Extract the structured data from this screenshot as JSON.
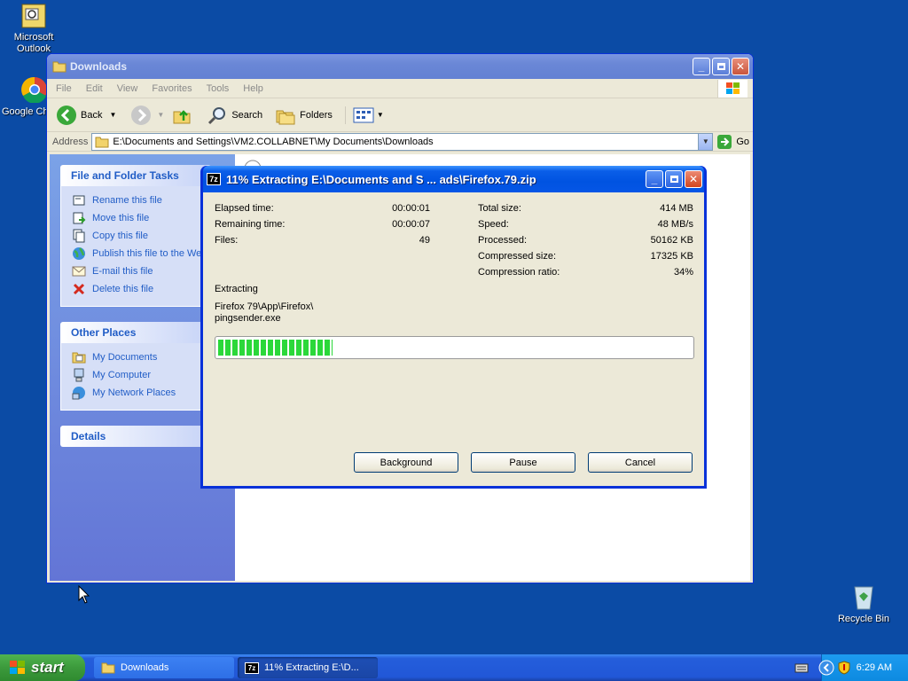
{
  "desktop": {
    "icons": [
      {
        "label": "Microsoft Outlook"
      },
      {
        "label": "Google Ch"
      },
      {
        "label": "Recycle Bin"
      }
    ]
  },
  "explorer": {
    "title": "Downloads",
    "menu": [
      "File",
      "Edit",
      "View",
      "Favorites",
      "Tools",
      "Help"
    ],
    "toolbar": {
      "back": "Back",
      "search": "Search",
      "folders": "Folders"
    },
    "address": {
      "label": "Address",
      "value": "E:\\Documents and Settings\\VM2.COLLABNET\\My Documents\\Downloads",
      "go": "Go"
    },
    "tasks": {
      "file_folder_title": "File and Folder Tasks",
      "file_folder_items": [
        "Rename this file",
        "Move this file",
        "Copy this file",
        "Publish this file to the Web",
        "E-mail this file",
        "Delete this file"
      ],
      "other_places_title": "Other Places",
      "other_places_items": [
        "My Documents",
        "My Computer",
        "My Network Places"
      ],
      "details_title": "Details"
    }
  },
  "dialog": {
    "title": "11% Extracting E:\\Documents and S ... ads\\Firefox.79.zip",
    "stats_left": [
      {
        "label": "Elapsed time:",
        "value": "00:00:01"
      },
      {
        "label": "Remaining time:",
        "value": "00:00:07"
      },
      {
        "label": "Files:",
        "value": "49"
      }
    ],
    "stats_right": [
      {
        "label": "Total size:",
        "value": "414 MB"
      },
      {
        "label": "Speed:",
        "value": "48 MB/s"
      },
      {
        "label": "Processed:",
        "value": "50162 KB"
      },
      {
        "label": "Compressed size:",
        "value": "17325 KB"
      },
      {
        "label": "Compression ratio:",
        "value": "34%"
      }
    ],
    "status": "Extracting",
    "current_path": "Firefox 79\\App\\Firefox\\",
    "current_file": "pingsender.exe",
    "progress_percent": 11,
    "buttons": {
      "background": "Background",
      "pause": "Pause",
      "cancel": "Cancel"
    },
    "accent_color": "#2bd83a"
  },
  "taskbar": {
    "start": "start",
    "tasks": [
      {
        "label": "Downloads"
      },
      {
        "label": "11% Extracting E:\\D..."
      }
    ],
    "clock": "6:29 AM"
  }
}
